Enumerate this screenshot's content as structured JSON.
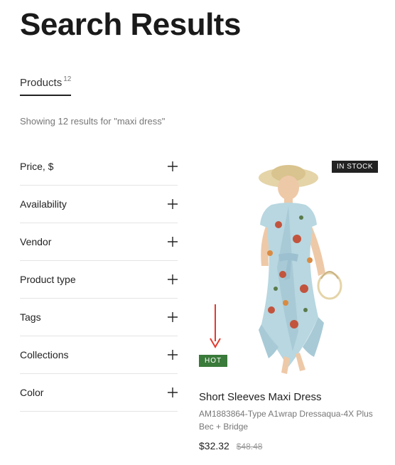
{
  "page_title": "Search Results",
  "tab": {
    "label": "Products",
    "count": "12"
  },
  "showing_text": "Showing 12 results for \"maxi dress\"",
  "filters": [
    {
      "label": "Price, $"
    },
    {
      "label": "Availability"
    },
    {
      "label": "Vendor"
    },
    {
      "label": "Product type"
    },
    {
      "label": "Tags"
    },
    {
      "label": "Collections"
    },
    {
      "label": "Color"
    }
  ],
  "product": {
    "instock_label": "IN STOCK",
    "hot_label": "HOT",
    "name": "Short Sleeves Maxi Dress",
    "subtitle": "AM1883864-Type A1wrap Dressaqua-4X Plus Bec + Bridge",
    "price_sale": "$32.32",
    "price_orig": "$48.48"
  }
}
